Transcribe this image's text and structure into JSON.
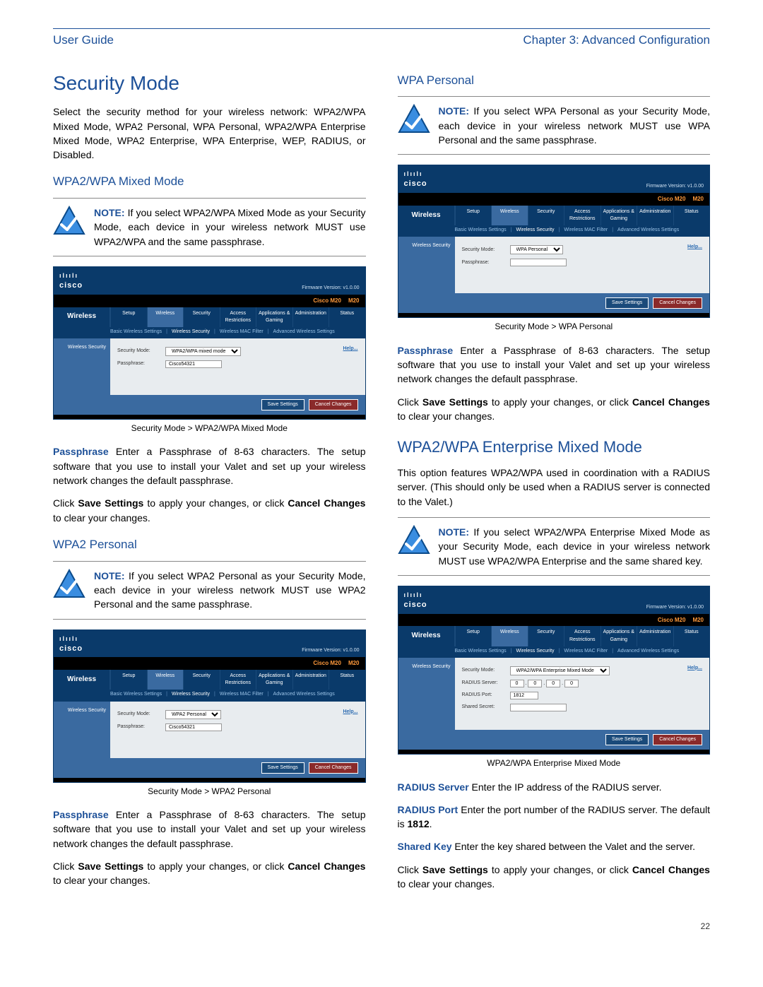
{
  "header": {
    "left": "User Guide",
    "right": "Chapter 3: Advanced Configuration"
  },
  "page_number": "22",
  "left": {
    "h1": "Security Mode",
    "intro": "Select the security method for your wireless network: WPA2/WPA Mixed Mode, WPA2 Personal, WPA Personal, WPA2/WPA Enterprise Mixed Mode, WPA2 Enterprise, WPA Enterprise, WEP, RADIUS, or Disabled.",
    "sub1": "WPA2/WPA Mixed Mode",
    "note1": {
      "lead": "NOTE:",
      "text": " If you select WPA2/WPA Mixed Mode as your Security Mode, each device in your wireless network MUST use WPA2/WPA and the same passphrase."
    },
    "caption1": "Security Mode > WPA2/WPA Mixed Mode",
    "passphrase_para": {
      "label": "Passphrase",
      "text": "  Enter a Passphrase of 8-63 characters. The setup software that you use to install your Valet and set up your wireless network changes the default passphrase."
    },
    "save_para": {
      "p1": "Click ",
      "s1": "Save Settings",
      "p2": " to apply your changes, or click ",
      "s2": "Cancel Changes",
      "p3": " to clear your changes."
    },
    "sub2": "WPA2 Personal",
    "note2": {
      "lead": "NOTE:",
      "text": " If you select WPA2 Personal as your Security Mode, each device in your wireless network MUST use WPA2 Personal and the same passphrase."
    },
    "caption2": "Security Mode > WPA2 Personal",
    "shot1": {
      "security_mode": "WPA2/WPA mixed mode",
      "passphrase": "Cisco54321"
    },
    "shot2": {
      "security_mode": "WPA2 Personal",
      "passphrase": "Cisco54321"
    }
  },
  "right": {
    "sub1": "WPA Personal",
    "note1": {
      "lead": "NOTE:",
      "text": " If you select WPA Personal as your Security Mode, each device in your wireless network MUST use WPA Personal and the same passphrase."
    },
    "caption1": "Security Mode > WPA Personal",
    "shot1": {
      "security_mode": "WPA Personal",
      "passphrase": ""
    },
    "h2": "WPA2/WPA Enterprise Mixed Mode",
    "ent_intro": "This option features WPA2/WPA used in coordination with a RADIUS server. (This should only be used when a RADIUS server is connected to the Valet.)",
    "note2": {
      "lead": "NOTE:",
      "text": " If you select WPA2/WPA Enterprise Mixed Mode as your Security Mode, each device in your wireless network MUST use WPA2/WPA Enterprise and the same shared key."
    },
    "shot2": {
      "security_mode": "WPA2/WPA Enterprise Mixed Mode",
      "radius_server": [
        "0",
        "0",
        "0",
        "0"
      ],
      "radius_port": "1812",
      "shared_secret": ""
    },
    "caption2": "WPA2/WPA Enterprise Mixed Mode",
    "radius_server": {
      "label": "RADIUS Server",
      "text": "  Enter the IP address of the RADIUS server."
    },
    "radius_port": {
      "label": "RADIUS Port",
      "text": "  Enter the port number of the RADIUS server. The default is ",
      "val": "1812",
      "text2": "."
    },
    "shared_key": {
      "label": "Shared Key",
      "text": "  Enter the key shared between the Valet and the server."
    }
  },
  "shot_common": {
    "logo": "cisco",
    "fw": "Firmware Version: v1.0.00",
    "model1": "Cisco M20",
    "model2": "M20",
    "side": "Wireless",
    "tabs": [
      "Setup",
      "Wireless",
      "Security",
      "Access Restrictions",
      "Applications & Gaming",
      "Administration",
      "Status"
    ],
    "subtabs": [
      "Basic Wireless Settings",
      "Wireless Security",
      "Wireless MAC Filter",
      "Advanced Wireless Settings"
    ],
    "panel_label": "Wireless Security",
    "field_security": "Security Mode:",
    "field_passphrase": "Passphrase:",
    "field_radius_server": "RADIUS Server:",
    "field_radius_port": "RADIUS Port:",
    "field_shared_secret": "Shared Secret:",
    "help": "Help...",
    "save": "Save Settings",
    "cancel": "Cancel Changes"
  }
}
